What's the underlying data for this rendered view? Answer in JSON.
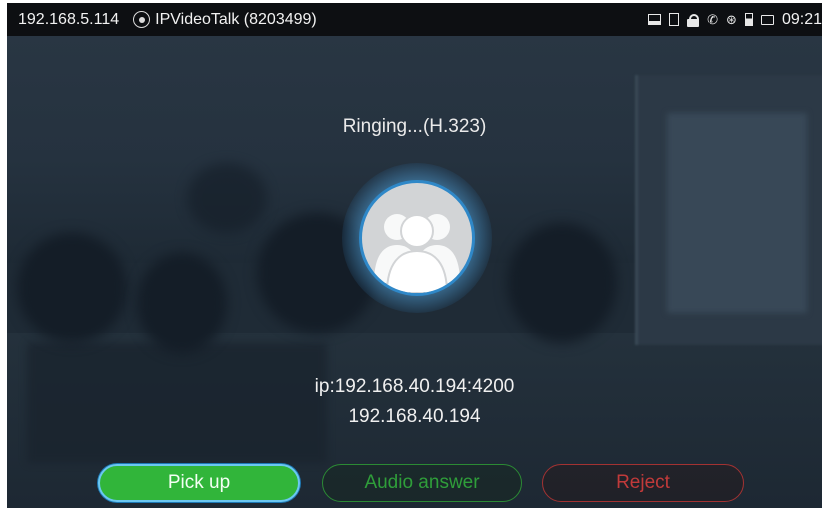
{
  "status_bar": {
    "ip_address": "192.168.5.114",
    "account_icon": "account-circle-icon",
    "account_name": "IPVideoTalk (8203499)",
    "icons": [
      "display-icon",
      "sd-card-icon",
      "lock-icon",
      "call-forward-icon",
      "bluetooth-icon",
      "battery-icon",
      "message-icon"
    ],
    "time": "09:21"
  },
  "call": {
    "state": "Ringing...(H.323)",
    "avatar_icon": "contact-group-icon",
    "remote_uri": "ip:192.168.40.194:4200",
    "remote_number": "192.168.40.194"
  },
  "actions": {
    "pick_up": "Pick up",
    "audio_answer": "Audio answer",
    "reject": "Reject"
  },
  "colors": {
    "pick_up": "#31b53a",
    "audio_answer": "#2f9e3a",
    "reject": "#c13a3a",
    "avatar_ring": "#2f88c8"
  }
}
